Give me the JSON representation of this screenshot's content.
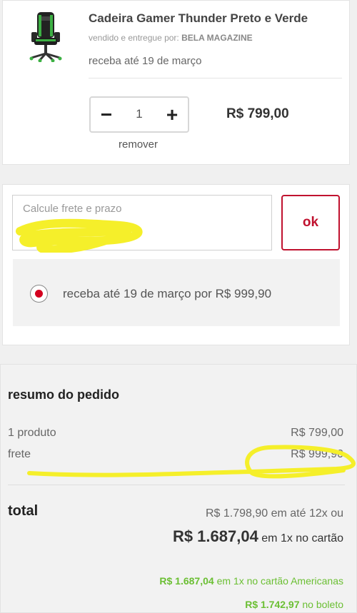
{
  "product": {
    "title": "Cadeira Gamer Thunder Preto e Verde",
    "seller_prefix": "vendido e entregue por:",
    "seller_name": "BELA MAGAZINE",
    "delivery": "receba até 19 de março",
    "quantity": "1",
    "minus_label": "−",
    "plus_label": "+",
    "price": "R$ 799,00",
    "remove_label": "remover",
    "image_icon": "gaming-chair-image"
  },
  "shipping": {
    "input_placeholder": "Calcule frete e prazo",
    "ok_label": "ok",
    "option_text": "receba até 19 de março por R$ 999,90",
    "accent_color": "#c0122f"
  },
  "summary": {
    "title": "resumo do pedido",
    "products_label": "1 produto",
    "products_value": "R$ 799,00",
    "frete_label": "frete",
    "frete_value": "R$ 999,90",
    "total_label": "total",
    "installment": "R$ 1.798,90 em até 12x ou",
    "total_price": "R$ 1.687,04",
    "total_suffix": "em 1x no cartão",
    "card_offer_price": "R$ 1.687,04",
    "card_offer_text": "em 1x no cartão Americanas",
    "boleto_price": "R$ 1.742,97",
    "boleto_text": "no boleto",
    "green_color": "#6bbf33"
  }
}
